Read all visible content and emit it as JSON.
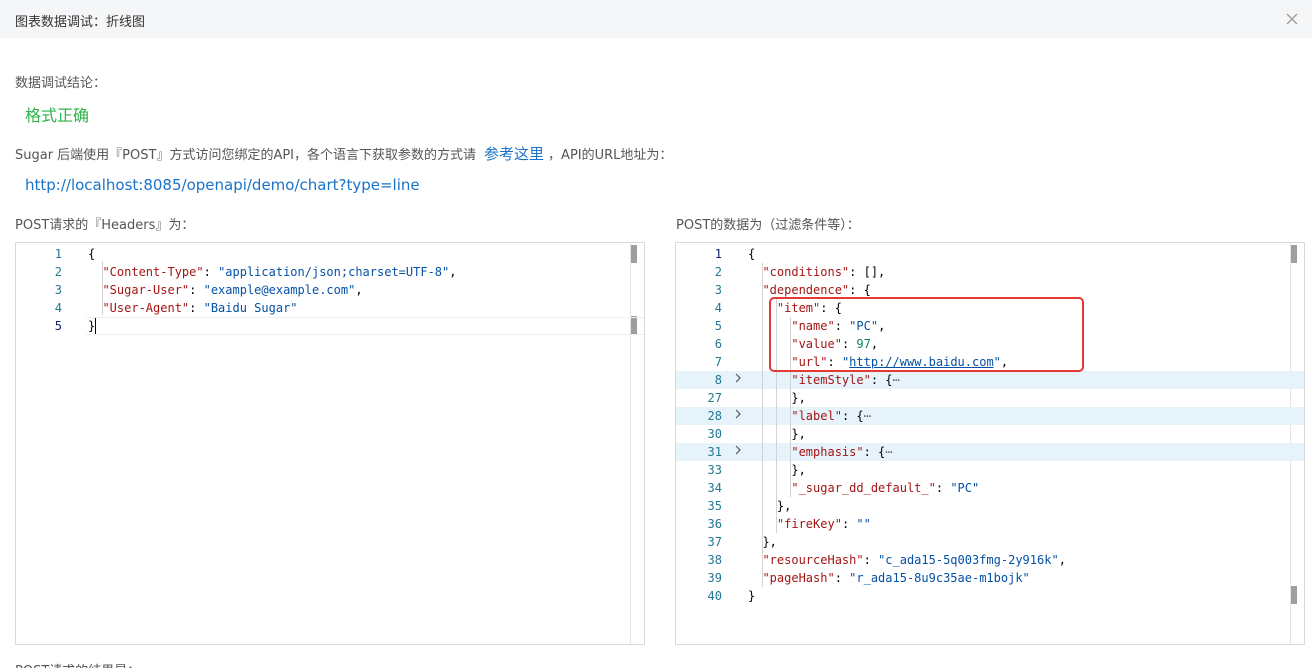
{
  "dialog": {
    "title": "图表数据调试：折线图"
  },
  "result": {
    "label": "数据调试结论：",
    "status": "格式正确"
  },
  "description": {
    "prefix": "Sugar 后端使用『POST』方式访问您绑定的API，各个语言下获取参数的方式请",
    "link_text": "参考这里",
    "suffix": "，API的URL地址为："
  },
  "api_url": "http://localhost:8085/openapi/demo/chart?type=line",
  "headers_panel": {
    "label": "POST请求的『Headers』为：",
    "lines": [
      {
        "num": "1",
        "tokens": [
          [
            "p",
            "{"
          ]
        ]
      },
      {
        "num": "2",
        "tokens": [
          [
            "p",
            "  "
          ],
          [
            "k",
            "\"Content-Type\""
          ],
          [
            "p",
            ": "
          ],
          [
            "s",
            "\"application/json;charset=UTF-8\""
          ],
          [
            "p",
            ","
          ]
        ]
      },
      {
        "num": "3",
        "tokens": [
          [
            "p",
            "  "
          ],
          [
            "k",
            "\"Sugar-User\""
          ],
          [
            "p",
            ": "
          ],
          [
            "s",
            "\"example@example.com\""
          ],
          [
            "p",
            ","
          ]
        ]
      },
      {
        "num": "4",
        "tokens": [
          [
            "p",
            "  "
          ],
          [
            "k",
            "\"User-Agent\""
          ],
          [
            "p",
            ": "
          ],
          [
            "s",
            "\"Baidu Sugar\""
          ]
        ]
      },
      {
        "num": "5",
        "tokens": [
          [
            "p",
            "}"
          ]
        ],
        "current": true
      }
    ]
  },
  "post_data_panel": {
    "label": "POST的数据为（过滤条件等）：",
    "lines": [
      {
        "num": "1",
        "tokens": [
          [
            "p",
            "{"
          ]
        ],
        "current": true
      },
      {
        "num": "2",
        "tokens": [
          [
            "p",
            "  "
          ],
          [
            "k",
            "\"conditions\""
          ],
          [
            "p",
            ": [],"
          ]
        ]
      },
      {
        "num": "3",
        "tokens": [
          [
            "p",
            "  "
          ],
          [
            "k",
            "\"dependence\""
          ],
          [
            "p",
            ": {"
          ]
        ]
      },
      {
        "num": "4",
        "tokens": [
          [
            "p",
            "    "
          ],
          [
            "k",
            "\"item\""
          ],
          [
            "p",
            ": {"
          ]
        ]
      },
      {
        "num": "5",
        "tokens": [
          [
            "p",
            "      "
          ],
          [
            "k",
            "\"name\""
          ],
          [
            "p",
            ": "
          ],
          [
            "s",
            "\"PC\""
          ],
          [
            "p",
            ","
          ]
        ]
      },
      {
        "num": "6",
        "tokens": [
          [
            "p",
            "      "
          ],
          [
            "k",
            "\"value\""
          ],
          [
            "p",
            ": "
          ],
          [
            "n",
            "97"
          ],
          [
            "p",
            ","
          ]
        ]
      },
      {
        "num": "7",
        "tokens": [
          [
            "p",
            "      "
          ],
          [
            "k",
            "\"url\""
          ],
          [
            "p",
            ": "
          ],
          [
            "s",
            "\""
          ],
          [
            "u",
            "http://www.baidu.com"
          ],
          [
            "s",
            "\""
          ],
          [
            "p",
            ","
          ]
        ]
      },
      {
        "num": "8",
        "tokens": [
          [
            "p",
            "      "
          ],
          [
            "k",
            "\"itemStyle\""
          ],
          [
            "p",
            ": {"
          ],
          [
            "ell",
            "⋯"
          ]
        ],
        "folded": true
      },
      {
        "num": "27",
        "tokens": [
          [
            "p",
            "      },"
          ]
        ]
      },
      {
        "num": "28",
        "tokens": [
          [
            "p",
            "      "
          ],
          [
            "k",
            "\"label\""
          ],
          [
            "p",
            ": {"
          ],
          [
            "ell",
            "⋯"
          ]
        ],
        "folded": true
      },
      {
        "num": "30",
        "tokens": [
          [
            "p",
            "      },"
          ]
        ]
      },
      {
        "num": "31",
        "tokens": [
          [
            "p",
            "      "
          ],
          [
            "k",
            "\"emphasis\""
          ],
          [
            "p",
            ": {"
          ],
          [
            "ell",
            "⋯"
          ]
        ],
        "folded": true
      },
      {
        "num": "33",
        "tokens": [
          [
            "p",
            "      },"
          ]
        ]
      },
      {
        "num": "34",
        "tokens": [
          [
            "p",
            "      "
          ],
          [
            "k",
            "\"_sugar_dd_default_\""
          ],
          [
            "p",
            ": "
          ],
          [
            "s",
            "\"PC\""
          ]
        ]
      },
      {
        "num": "35",
        "tokens": [
          [
            "p",
            "    },"
          ]
        ]
      },
      {
        "num": "36",
        "tokens": [
          [
            "p",
            "    "
          ],
          [
            "k",
            "\"fireKey\""
          ],
          [
            "p",
            ": "
          ],
          [
            "s",
            "\"\""
          ]
        ]
      },
      {
        "num": "37",
        "tokens": [
          [
            "p",
            "  },"
          ]
        ]
      },
      {
        "num": "38",
        "tokens": [
          [
            "p",
            "  "
          ],
          [
            "k",
            "\"resourceHash\""
          ],
          [
            "p",
            ": "
          ],
          [
            "s",
            "\"c_ada15-5q003fmg-2y916k\""
          ],
          [
            "p",
            ","
          ]
        ]
      },
      {
        "num": "39",
        "tokens": [
          [
            "p",
            "  "
          ],
          [
            "k",
            "\"pageHash\""
          ],
          [
            "p",
            ": "
          ],
          [
            "s",
            "\"r_ada15-8u9c35ae-m1bojk\""
          ]
        ]
      },
      {
        "num": "40",
        "tokens": [
          [
            "p",
            "}"
          ]
        ]
      }
    ]
  },
  "response_label": "POST请求的结果是："
}
